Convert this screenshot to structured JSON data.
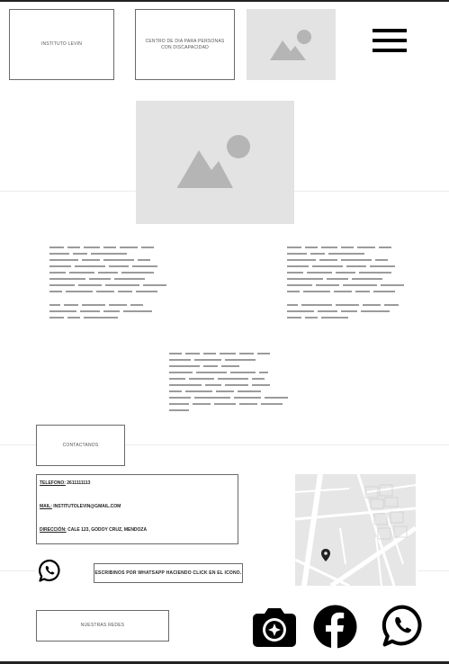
{
  "header": {
    "logo_label": "INSTITUTO LEVIN",
    "subtitle_label": "CENTRO DE DIA PARA PERSONAS CON DISCAPACIDAD",
    "image_icon": "image-placeholder-icon",
    "menu_icon": "hamburger-menu-icon"
  },
  "hero": {
    "image_icon": "image-placeholder-icon"
  },
  "contact": {
    "button_label": "CONTACTANOS",
    "phone_key": "TELEFONO:",
    "phone_value": "2611111113",
    "email_key": "MAIL:",
    "email_value": "INSTITUTOLEVIN@GMAIL.COM",
    "address_key": "DIRECCIÓN:",
    "address_value": "CALE 123, GODOY CRUZ, MENDOZA",
    "whatsapp_text": "ESCRIBINOS POR WHATSAPP HACIENDO CLICK EN EL ICONO.",
    "map_icon": "map-pin-icon",
    "whatsapp_icon": "whatsapp-icon"
  },
  "social": {
    "label": "NUESTRAS REDES",
    "icons": [
      "camera-icon",
      "facebook-icon",
      "whatsapp-icon"
    ]
  },
  "colors": {
    "border": "#6a6a6a",
    "placeholder_bg": "#e3e3e3",
    "placeholder_shape": "#b5b5b5",
    "text_line": "#9b9b9b",
    "icon": "#000000"
  }
}
